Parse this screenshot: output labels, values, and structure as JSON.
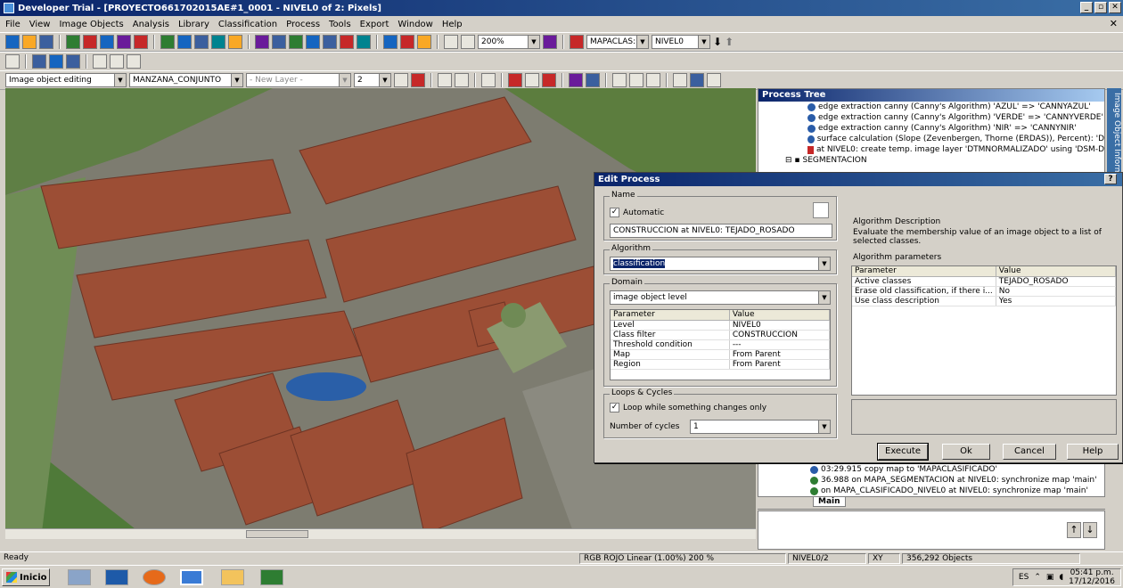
{
  "window": {
    "title": "Developer Trial - [PROYECTO661702015AE#1_0001 - NIVEL0 of 2: Pixels]"
  },
  "menu": [
    "File",
    "View",
    "Image Objects",
    "Analysis",
    "Library",
    "Classification",
    "Process",
    "Tools",
    "Export",
    "Window",
    "Help"
  ],
  "toolbar1": {
    "zoom": "200%",
    "map_combo": "MAPACLAS:",
    "level_combo": "NIVEL0"
  },
  "toolbar3": {
    "mode_combo": "Image object editing",
    "class_combo": "MANZANA_CONJUNTO",
    "layer_combo": "- New Layer -",
    "number_combo": "2"
  },
  "process_tree": {
    "title": "Process Tree",
    "lines": [
      "edge extraction canny (Canny's Algorithm) 'AZUL' => 'CANNYAZUL'",
      "edge extraction canny (Canny's Algorithm) 'VERDE' => 'CANNYVERDE'",
      "edge extraction canny (Canny's Algorithm) 'NIR' => 'CANNYNIR'",
      "surface calculation (Slope (Zevenbergen, Thorne (ERDAS)), Percent): 'D",
      "at NIVEL0: create temp. image layer 'DTMNORMALIZADO' using 'DSM-D",
      "SEGMENTACION"
    ]
  },
  "side_tab": "Image Object Informatio",
  "lower_panel": {
    "lines": [
      "03:29.915  copy map to 'MAPACLASIFICADO'",
      "36.988   on MAPA_SEGMENTACION at NIVEL0: synchronize map 'main'",
      "on MAPA_CLASIFICADO_NIVEL0 at NIVEL0: synchronize map 'main'"
    ],
    "tab": "Main"
  },
  "dialog": {
    "title": "Edit Process",
    "help": "?",
    "name_group": "Name",
    "automatic_label": "Automatic",
    "name_value": "CONSTRUCCION at  NIVEL0: TEJADO_ROSADO",
    "algorithm_group": "Algorithm",
    "algorithm_value": "classification",
    "domain_group": "Domain",
    "domain_value": "image object level",
    "domain_params": {
      "headers": [
        "Parameter",
        "Value"
      ],
      "rows": [
        [
          "Level",
          "NIVEL0"
        ],
        [
          "Class filter",
          "CONSTRUCCION"
        ],
        [
          "Threshold condition",
          "---"
        ],
        [
          "Map",
          "From Parent"
        ],
        [
          "Region",
          "From Parent"
        ]
      ]
    },
    "loops_group": "Loops & Cycles",
    "loop_label": "Loop while something changes only",
    "cycles_label": "Number of cycles",
    "cycles_value": "1",
    "algo_desc_group": "Algorithm Description",
    "algo_desc_text": "Evaluate the membership value of an image object to a list of selected classes.",
    "algo_params_group": "Algorithm parameters",
    "algo_params": {
      "headers": [
        "Parameter",
        "Value"
      ],
      "rows": [
        [
          "Active classes",
          "TEJADO_ROSADO"
        ],
        [
          "Erase old classification, if there i...",
          "No"
        ],
        [
          "Use class description",
          "Yes"
        ]
      ]
    },
    "buttons": {
      "execute": "Execute",
      "ok": "Ok",
      "cancel": "Cancel",
      "help": "Help"
    }
  },
  "statusbar": {
    "ready": "Ready",
    "rgb": "RGB  ROJO  Linear (1.00%)  200 %",
    "level": "NIVEL0/2",
    "xy": "XY",
    "objects": "356,292 Objects"
  },
  "taskbar": {
    "start": "Inicio",
    "lang": "ES",
    "time": "05:41 p.m.",
    "date": "17/12/2016"
  }
}
